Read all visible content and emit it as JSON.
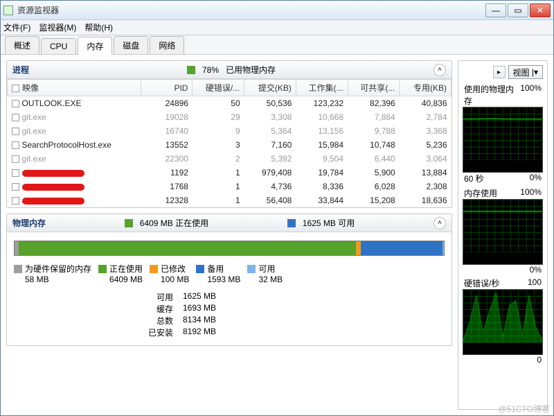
{
  "window": {
    "title": "资源监视器"
  },
  "menu": {
    "file": "文件(F)",
    "monitor": "监视器(M)",
    "help": "帮助(H)"
  },
  "tabs": {
    "overview": "概述",
    "cpu": "CPU",
    "memory": "内存",
    "disk": "磁盘",
    "network": "网络"
  },
  "side": {
    "view_btn": "视图",
    "charts": [
      {
        "title": "使用的物理内存",
        "max": "100%",
        "xl": "60 秒",
        "xr": "0%"
      },
      {
        "title": "内存使用",
        "max": "100%",
        "xl": "",
        "xr": "0%"
      },
      {
        "title": "硬错误/秒",
        "max": "100",
        "xl": "",
        "xr": "0"
      }
    ]
  },
  "proc": {
    "title": "进程",
    "usage_pct": "78%",
    "usage_label": "已用物理内存",
    "cols": [
      "映像",
      "PID",
      "硬错误/...",
      "提交(KB)",
      "工作集(...",
      "可共享(...",
      "专用(KB)"
    ],
    "rows": [
      {
        "dim": false,
        "cells": [
          "OUTLOOK.EXE",
          "24896",
          "50",
          "50,536",
          "123,232",
          "82,396",
          "40,836"
        ]
      },
      {
        "dim": true,
        "cells": [
          "git.exe",
          "19028",
          "29",
          "3,308",
          "10,668",
          "7,884",
          "2,784"
        ]
      },
      {
        "dim": true,
        "cells": [
          "git.exe",
          "16740",
          "9",
          "5,364",
          "13,156",
          "9,788",
          "3,368"
        ]
      },
      {
        "dim": false,
        "cells": [
          "SearchProtocolHost.exe",
          "13552",
          "3",
          "7,160",
          "15,984",
          "10,748",
          "5,236"
        ]
      },
      {
        "dim": true,
        "cells": [
          "git.exe",
          "22300",
          "2",
          "5,392",
          "9,504",
          "6,440",
          "3,064"
        ]
      },
      {
        "dim": false,
        "redact": true,
        "cells": [
          "",
          "1192",
          "1",
          "979,408",
          "19,784",
          "5,900",
          "13,884"
        ]
      },
      {
        "dim": false,
        "redact": true,
        "cells": [
          "",
          "1768",
          "1",
          "4,736",
          "8,336",
          "6,028",
          "2,308"
        ]
      },
      {
        "dim": false,
        "redact": true,
        "cells": [
          "",
          "12328",
          "1",
          "56,408",
          "33,844",
          "15,208",
          "18,636"
        ]
      }
    ]
  },
  "phys": {
    "title": "物理内存",
    "inuse_label": "6409 MB 正在使用",
    "avail_label": "1625 MB 可用",
    "legend": [
      {
        "color": "#9e9e9e",
        "label": "为硬件保留的内存",
        "val": "58 MB"
      },
      {
        "color": "#56a22a",
        "label": "正在使用",
        "val": "6409 MB"
      },
      {
        "color": "#f29a1f",
        "label": "已修改",
        "val": "100 MB"
      },
      {
        "color": "#2f74c4",
        "label": "备用",
        "val": "1593 MB"
      },
      {
        "color": "#7fb4e8",
        "label": "可用",
        "val": "32 MB"
      }
    ],
    "stats": [
      {
        "k": "可用",
        "v": "1625 MB"
      },
      {
        "k": "缓存",
        "v": "1693 MB"
      },
      {
        "k": "总数",
        "v": "8134 MB"
      },
      {
        "k": "已安装",
        "v": "8192 MB"
      }
    ]
  },
  "chart_data": [
    {
      "type": "line",
      "title": "使用的物理内存",
      "ylim": [
        0,
        100
      ],
      "ylabel": "%",
      "x": [
        0,
        10,
        20,
        30,
        40,
        50,
        60
      ],
      "values": [
        78,
        78,
        79,
        78,
        78,
        78,
        78
      ]
    },
    {
      "type": "line",
      "title": "内存使用",
      "ylim": [
        0,
        100
      ],
      "ylabel": "%",
      "x": [
        0,
        10,
        20,
        30,
        40,
        50,
        60
      ],
      "values": [
        78,
        78,
        78,
        78,
        78,
        78,
        78
      ]
    },
    {
      "type": "area",
      "title": "硬错误/秒",
      "ylim": [
        0,
        100
      ],
      "x": [
        0,
        5,
        10,
        15,
        20,
        25,
        30,
        35,
        40,
        45,
        50,
        55,
        60
      ],
      "values": [
        5,
        40,
        90,
        20,
        60,
        95,
        10,
        70,
        80,
        15,
        90,
        30,
        5
      ]
    }
  ],
  "watermark": "@51CTO博客"
}
